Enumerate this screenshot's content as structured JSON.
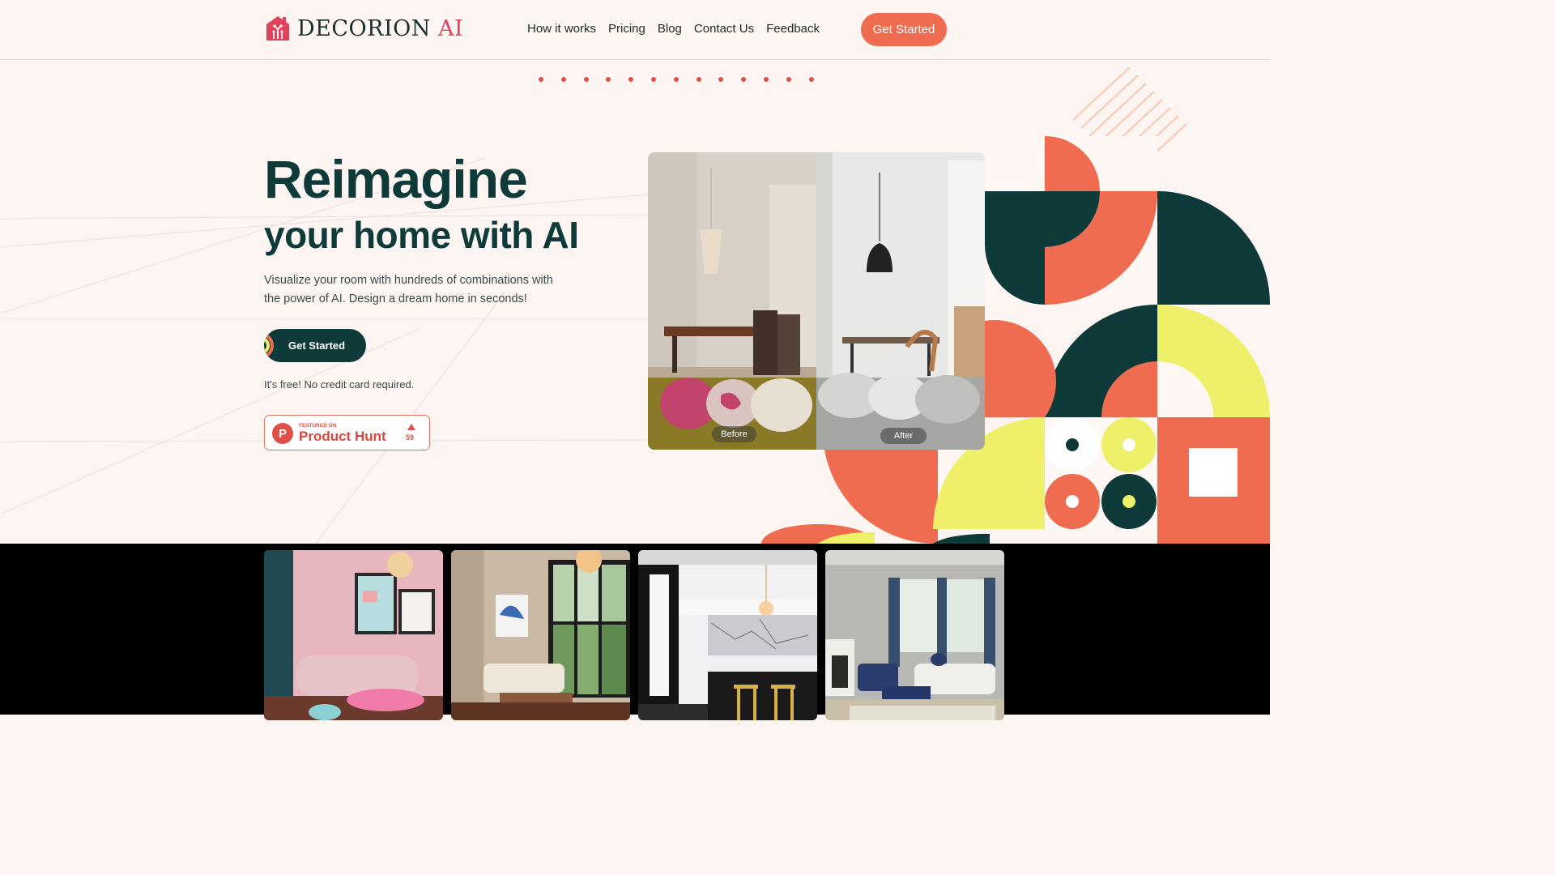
{
  "brand": {
    "name": "DECORION",
    "suffix": "AI"
  },
  "nav": {
    "items": [
      "How it works",
      "Pricing",
      "Blog",
      "Contact Us",
      "Feedback"
    ]
  },
  "header": {
    "cta_label": "Get Started"
  },
  "hero": {
    "title": "Reimagine",
    "subtitle": "your home with AI",
    "description": "Visualize your room with hundreds of combinations with the power of AI. Design a dream home in seconds!",
    "cta_label": "Get Started",
    "note": "It's free! No credit card required."
  },
  "product_hunt": {
    "featured": "FEATURED ON",
    "name": "Product Hunt",
    "logo_letter": "P",
    "count": "59"
  },
  "comparison": {
    "before_label": "Before",
    "after_label": "After"
  },
  "colors": {
    "accent": "#f06c50",
    "dark": "#0e3a3a",
    "yellow": "#eef06a",
    "pink": "#e0425c",
    "background": "#fdf5f1"
  }
}
